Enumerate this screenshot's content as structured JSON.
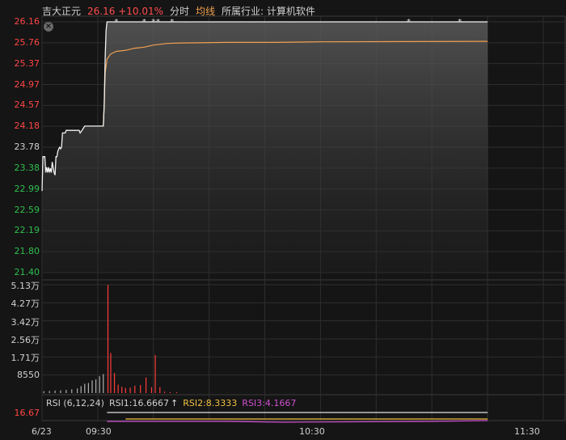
{
  "header": {
    "stock_name": "吉大正元",
    "price": "26.16",
    "change_pct": "+10.01%",
    "tab_intraday": "分时",
    "tab_avg_line": "均线",
    "industry": "所属行业: 计算机软件"
  },
  "close_button": "×",
  "price_axis": {
    "labels": [
      "26.16",
      "25.76",
      "25.37",
      "24.97",
      "24.57",
      "24.18",
      "23.78",
      "23.38",
      "22.99",
      "22.59",
      "22.19",
      "21.80",
      "21.40"
    ],
    "colors": [
      "#ff4545",
      "#ff4545",
      "#ff4545",
      "#ff4545",
      "#ff4545",
      "#ff4545",
      "#d0d0d0",
      "#2fbf4f",
      "#2fbf4f",
      "#2fbf4f",
      "#2fbf4f",
      "#2fbf4f",
      "#2fbf4f"
    ]
  },
  "volume_axis": {
    "labels": [
      "5.13万",
      "4.27万",
      "3.42万",
      "2.56万",
      "1.71万",
      "8550"
    ]
  },
  "rsi": {
    "title": "RSI (6,12,24)",
    "rsi1": "RSI1:16.6667",
    "rsi2": "RSI2:8.3333",
    "rsi3": "RSI3:4.1667",
    "axis_value": "16.67",
    "colors": {
      "rsi1": "#e0e0e0",
      "rsi2": "#f0c040",
      "rsi3": "#d050d0"
    }
  },
  "time_axis": {
    "date": "6/23",
    "t1": "09:30",
    "t2": "10:30",
    "t3": "11:30"
  },
  "chart_data": {
    "type": "line",
    "price_range": [
      21.4,
      26.16
    ],
    "price_series": [
      {
        "t": 0,
        "p": 22.95
      },
      {
        "t": 1,
        "p": 23.6
      },
      {
        "t": 3,
        "p": 23.6
      },
      {
        "t": 4,
        "p": 23.3
      },
      {
        "t": 5,
        "p": 23.4
      },
      {
        "t": 6,
        "p": 23.3
      },
      {
        "t": 7,
        "p": 23.4
      },
      {
        "t": 8,
        "p": 23.3
      },
      {
        "t": 9,
        "p": 23.38
      },
      {
        "t": 10,
        "p": 23.3
      },
      {
        "t": 11,
        "p": 23.5
      },
      {
        "t": 12,
        "p": 23.4
      },
      {
        "t": 13,
        "p": 23.3
      },
      {
        "t": 14,
        "p": 23.25
      },
      {
        "t": 15,
        "p": 23.6
      },
      {
        "t": 16,
        "p": 23.6
      },
      {
        "t": 17,
        "p": 23.7
      },
      {
        "t": 18,
        "p": 23.75
      },
      {
        "t": 19,
        "p": 23.78
      },
      {
        "t": 20,
        "p": 23.75
      },
      {
        "t": 21,
        "p": 23.78
      },
      {
        "t": 22,
        "p": 24.05
      },
      {
        "t": 25,
        "p": 24.05
      },
      {
        "t": 26,
        "p": 24.1
      },
      {
        "t": 40,
        "p": 24.1
      },
      {
        "t": 41,
        "p": 24.05
      },
      {
        "t": 43,
        "p": 24.1
      },
      {
        "t": 46,
        "p": 24.18
      },
      {
        "t": 66,
        "p": 24.18
      },
      {
        "t": 67,
        "p": 24.6
      },
      {
        "t": 68,
        "p": 25.5
      },
      {
        "t": 69,
        "p": 26.0
      },
      {
        "t": 70,
        "p": 26.16
      },
      {
        "t": 480,
        "p": 26.16
      }
    ],
    "avg_series": [
      {
        "t": 66,
        "p": 24.18
      },
      {
        "t": 67,
        "p": 24.6
      },
      {
        "t": 68,
        "p": 25.2
      },
      {
        "t": 70,
        "p": 25.45
      },
      {
        "t": 74,
        "p": 25.55
      },
      {
        "t": 80,
        "p": 25.6
      },
      {
        "t": 90,
        "p": 25.62
      },
      {
        "t": 100,
        "p": 25.66
      },
      {
        "t": 110,
        "p": 25.68
      },
      {
        "t": 120,
        "p": 25.72
      },
      {
        "t": 135,
        "p": 25.75
      },
      {
        "t": 150,
        "p": 25.76
      },
      {
        "t": 200,
        "p": 25.77
      },
      {
        "t": 250,
        "p": 25.77
      },
      {
        "t": 300,
        "p": 25.78
      },
      {
        "t": 480,
        "p": 25.79
      }
    ],
    "trade_markers": [
      80,
      110,
      120,
      125,
      140,
      395,
      450
    ],
    "volume_range": [
      0,
      51300
    ],
    "volume_bars": [
      {
        "t": 2,
        "v": 900
      },
      {
        "t": 8,
        "v": 1000
      },
      {
        "t": 14,
        "v": 1200
      },
      {
        "t": 20,
        "v": 1300
      },
      {
        "t": 26,
        "v": 1500
      },
      {
        "t": 32,
        "v": 1800
      },
      {
        "t": 38,
        "v": 2200
      },
      {
        "t": 42,
        "v": 3300
      },
      {
        "t": 46,
        "v": 4400
      },
      {
        "t": 50,
        "v": 4800
      },
      {
        "t": 54,
        "v": 6000
      },
      {
        "t": 58,
        "v": 6500
      },
      {
        "t": 62,
        "v": 8000
      },
      {
        "t": 66,
        "v": 9000
      },
      {
        "t": 71,
        "v": 51300
      },
      {
        "t": 74,
        "v": 19000
      },
      {
        "t": 78,
        "v": 9500
      },
      {
        "t": 82,
        "v": 4000
      },
      {
        "t": 86,
        "v": 3000
      },
      {
        "t": 90,
        "v": 2400
      },
      {
        "t": 95,
        "v": 2600
      },
      {
        "t": 100,
        "v": 3500
      },
      {
        "t": 106,
        "v": 3800
      },
      {
        "t": 112,
        "v": 7400
      },
      {
        "t": 118,
        "v": 2800
      },
      {
        "t": 122,
        "v": 18000
      },
      {
        "t": 127,
        "v": 2800
      },
      {
        "t": 132,
        "v": 700
      },
      {
        "t": 138,
        "v": 500
      },
      {
        "t": 145,
        "v": 400
      }
    ]
  }
}
